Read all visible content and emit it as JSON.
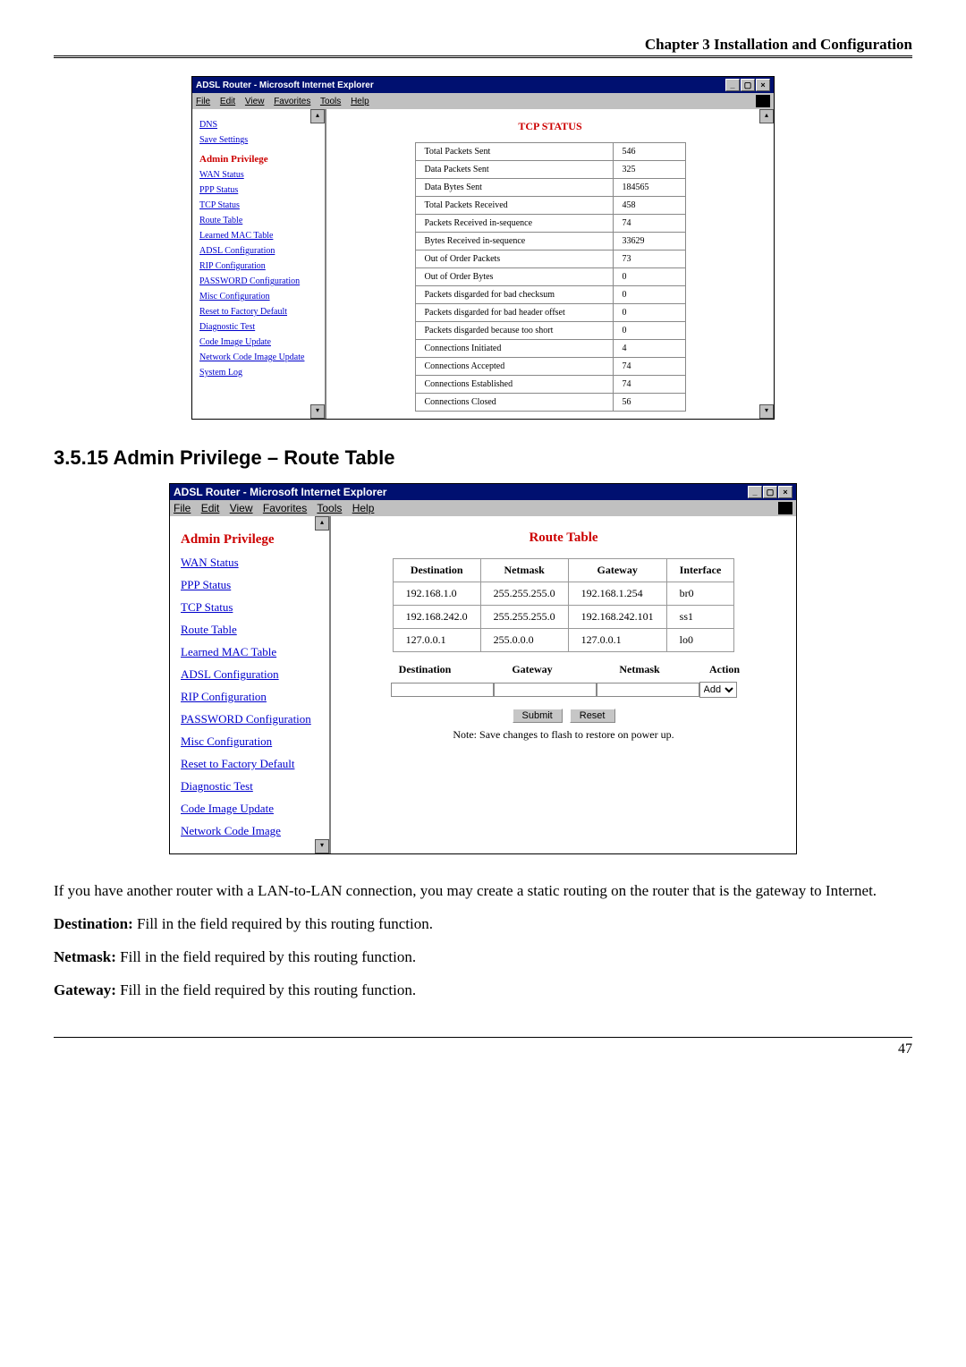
{
  "header": "Chapter 3 Installation and Configuration",
  "win_title": "ADSL Router - Microsoft Internet Explorer",
  "menus": [
    "File",
    "Edit",
    "View",
    "Favorites",
    "Tools",
    "Help"
  ],
  "shot1": {
    "sidebar_top": [
      "DNS",
      "Save Settings"
    ],
    "sidebar_heading": "Admin Privilege",
    "sidebar_items": [
      "WAN Status",
      "PPP Status",
      "TCP Status",
      "Route Table",
      "Learned MAC Table",
      "ADSL Configuration",
      "RIP Configuration",
      "PASSWORD Configuration",
      "Misc Configuration",
      "Reset to Factory Default",
      "Diagnostic Test",
      "Code Image Update",
      "Network Code Image Update",
      "System Log"
    ],
    "content_title": "TCP STATUS",
    "rows": [
      [
        "Total Packets Sent",
        "546"
      ],
      [
        "Data Packets Sent",
        "325"
      ],
      [
        "Data Bytes Sent",
        "184565"
      ],
      [
        "Total Packets Received",
        "458"
      ],
      [
        "Packets Received in-sequence",
        "74"
      ],
      [
        "Bytes Received in-sequence",
        "33629"
      ],
      [
        "Out of Order Packets",
        "73"
      ],
      [
        "Out of Order Bytes",
        "0"
      ],
      [
        "Packets disgarded for bad checksum",
        "0"
      ],
      [
        "Packets disgarded for bad header offset",
        "0"
      ],
      [
        "Packets disgarded because too short",
        "0"
      ],
      [
        "Connections Initiated",
        "4"
      ],
      [
        "Connections Accepted",
        "74"
      ],
      [
        "Connections Established",
        "74"
      ],
      [
        "Connections Closed",
        "56"
      ]
    ]
  },
  "section_heading": "3.5.15 Admin Privilege – Route Table",
  "shot2": {
    "sidebar_heading": "Admin Privilege",
    "sidebar_items": [
      "WAN Status",
      "PPP Status",
      "TCP Status",
      "Route Table",
      "Learned MAC Table",
      "ADSL Configuration",
      "RIP Configuration",
      "PASSWORD Configuration",
      "Misc Configuration",
      "Reset to Factory Default",
      "Diagnostic Test",
      "Code Image Update",
      "Network Code Image"
    ],
    "content_title": "Route Table",
    "table_headers": [
      "Destination",
      "Netmask",
      "Gateway",
      "Interface"
    ],
    "table_rows": [
      [
        "192.168.1.0",
        "255.255.255.0",
        "192.168.1.254",
        "br0"
      ],
      [
        "192.168.242.0",
        "255.255.255.0",
        "192.168.242.101",
        "ss1"
      ],
      [
        "127.0.0.1",
        "255.0.0.0",
        "127.0.0.1",
        "lo0"
      ]
    ],
    "add_headers": [
      "Destination",
      "Gateway",
      "Netmask",
      "Action"
    ],
    "action_option": "Add",
    "submit": "Submit",
    "reset": "Reset",
    "note": "Note: Save changes to flash to restore on power up."
  },
  "paragraphs": {
    "p1": "If you have another router with a LAN-to-LAN connection, you may create a static routing on the router that is the gateway to Internet.",
    "dest_label": "Destination:",
    "dest_text": " Fill in the field required by this routing function.",
    "net_label": "Netmask:",
    "net_text": " Fill in the field required by this routing function.",
    "gw_label": "Gateway:",
    "gw_text": " Fill in the field required by this routing function."
  },
  "page_number": "47"
}
